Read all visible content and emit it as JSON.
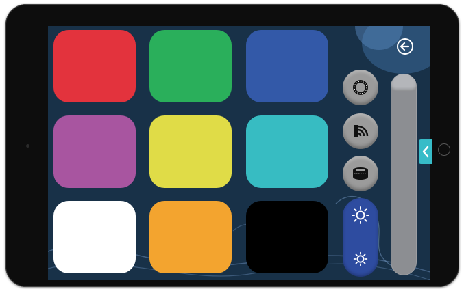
{
  "colors": {
    "screen_background": "#183148",
    "brightness_panel": "#2e4ca0",
    "side_tab": "#37bcc8"
  },
  "color_tiles": [
    {
      "name": "red",
      "color": "#e3333d"
    },
    {
      "name": "green",
      "color": "#2aaf5b"
    },
    {
      "name": "blue",
      "color": "#3359a8"
    },
    {
      "name": "purple",
      "color": "#a855a0"
    },
    {
      "name": "yellow",
      "color": "#e0dc47"
    },
    {
      "name": "cyan",
      "color": "#37bcc2"
    },
    {
      "name": "white",
      "color": "#ffffff"
    },
    {
      "name": "orange",
      "color": "#f3a42f"
    },
    {
      "name": "black",
      "color": "#000000"
    }
  ],
  "controls": {
    "icons": [
      "back-arrow-icon",
      "ring-icon",
      "wifi-icon",
      "speaker-icon",
      "brightness-up-icon",
      "brightness-down-icon",
      "chevron-left-icon"
    ]
  },
  "slider": {
    "level": 1.0
  }
}
